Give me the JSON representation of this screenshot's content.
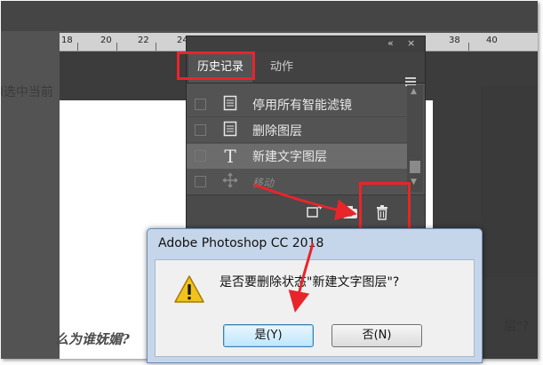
{
  "background": {
    "text_left": "l选中当前",
    "text_bottom": "么为谁妩媚?",
    "text_right": "层\"?",
    "ruler_numbers": [
      "18",
      "20",
      "22",
      "24",
      "38",
      "40"
    ]
  },
  "history_panel": {
    "tabs": [
      {
        "label": "历史记录",
        "active": true
      },
      {
        "label": "动作",
        "active": false
      }
    ],
    "collapse_label": "«",
    "close_label": "×",
    "items": [
      {
        "label": "停用所有智能滤镜",
        "icon": "document-icon"
      },
      {
        "label": "删除图层",
        "icon": "document-icon"
      },
      {
        "label": "新建文字图层",
        "icon": "type-tool-icon",
        "selected": true
      },
      {
        "label": "移动",
        "icon": "move-tool-icon",
        "dimmed": true
      }
    ],
    "bottom_buttons": [
      "new-document-from-state",
      "snapshot",
      "delete-state"
    ]
  },
  "dialog": {
    "title": "Adobe Photoshop CC 2018",
    "message": "是否要删除状态\"新建文字图层\"?",
    "yes_label": "是(Y)",
    "no_label": "否(N)"
  },
  "colors": {
    "highlight_red": "#e8252b",
    "panel_bg": "#535353",
    "dialog_title_bar": "#c6d6ea"
  }
}
